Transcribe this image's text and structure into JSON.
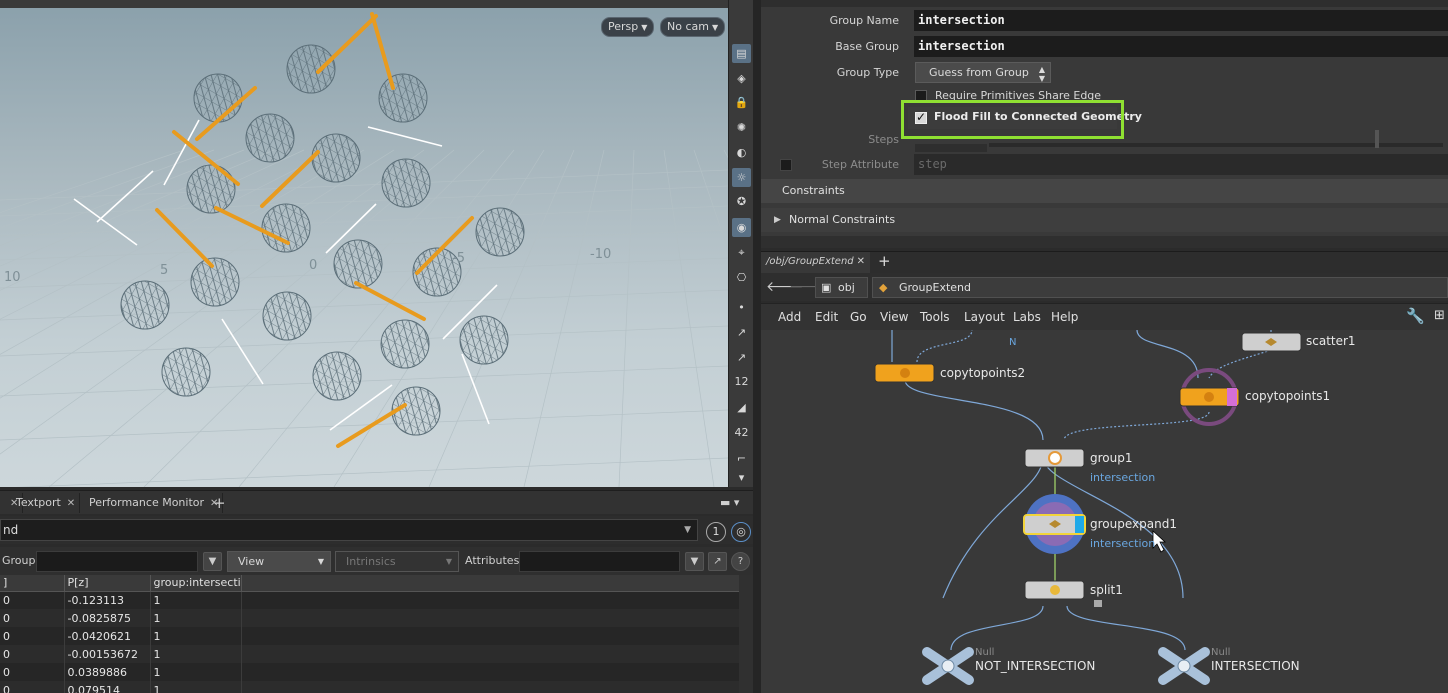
{
  "viewport": {
    "persp_label": "Persp",
    "cam_label": "No cam",
    "grid_labels": {
      "left": "10",
      "five": "5",
      "zero": "0",
      "neg_five": "-5",
      "neg_ten": "-10"
    }
  },
  "pane_tabs": [
    {
      "label": "Textport"
    },
    {
      "label": "Performance Monitor"
    }
  ],
  "spreadsheet": {
    "path_text": "nd",
    "count_badge": "1",
    "group_label": "Group:",
    "view_label": "View",
    "intrinsics_label": "Intrinsics",
    "attributes_label": "Attributes:",
    "columns": [
      "]",
      "P[z]",
      "group:intersecti"
    ],
    "rows": [
      [
        "0",
        "-0.123113",
        "1"
      ],
      [
        "0",
        "-0.0825875",
        "1"
      ],
      [
        "0",
        "-0.0420621",
        "1"
      ],
      [
        "0",
        "-0.00153672",
        "1"
      ],
      [
        "0",
        "0.0389886",
        "1"
      ],
      [
        "0",
        "0.079514",
        "1"
      ]
    ]
  },
  "params": {
    "group_name_label": "Group Name",
    "group_name_value": "intersection",
    "base_group_label": "Base Group",
    "base_group_value": "intersection",
    "group_type_label": "Group Type",
    "group_type_value": "Guess from Group",
    "require_share_edge_label": "Require Primitives Share Edge",
    "flood_fill_label": "Flood Fill to Connected Geometry",
    "flood_fill_checked": true,
    "steps_label": "Steps",
    "step_attribute_label": "Step Attribute",
    "step_attribute_value": "step",
    "constraints_label": "Constraints",
    "normal_constraints_label": "Normal Constraints",
    "highlight_color": "#8fe032"
  },
  "network": {
    "tab_label": "/obj/GroupExtend",
    "path_obj": "obj",
    "path_node": "GroupExtend",
    "menu": [
      "Add",
      "Edit",
      "Go",
      "View",
      "Tools",
      "Layout",
      "Labs",
      "Help"
    ],
    "nodes": {
      "copytopoints2": {
        "name": "copytopoints2"
      },
      "scatter1": {
        "name": "scatter1"
      },
      "copytopoints1": {
        "name": "copytopoints1"
      },
      "group1": {
        "name": "group1",
        "sub": "intersection"
      },
      "groupexpand1": {
        "name": "groupexpand1",
        "sub": "intersection"
      },
      "split1": {
        "name": "split1"
      },
      "not_intersection": {
        "type": "Null",
        "name": "NOT_INTERSECTION"
      },
      "intersection": {
        "type": "Null",
        "name": "INTERSECTION"
      }
    },
    "stray_label": "N"
  },
  "colors": {
    "copy_node": "#f0a21d",
    "selected_outline": "#f2d43a",
    "wire_blue": "#7fa8d8",
    "group_sub": "#6aa7e0"
  }
}
